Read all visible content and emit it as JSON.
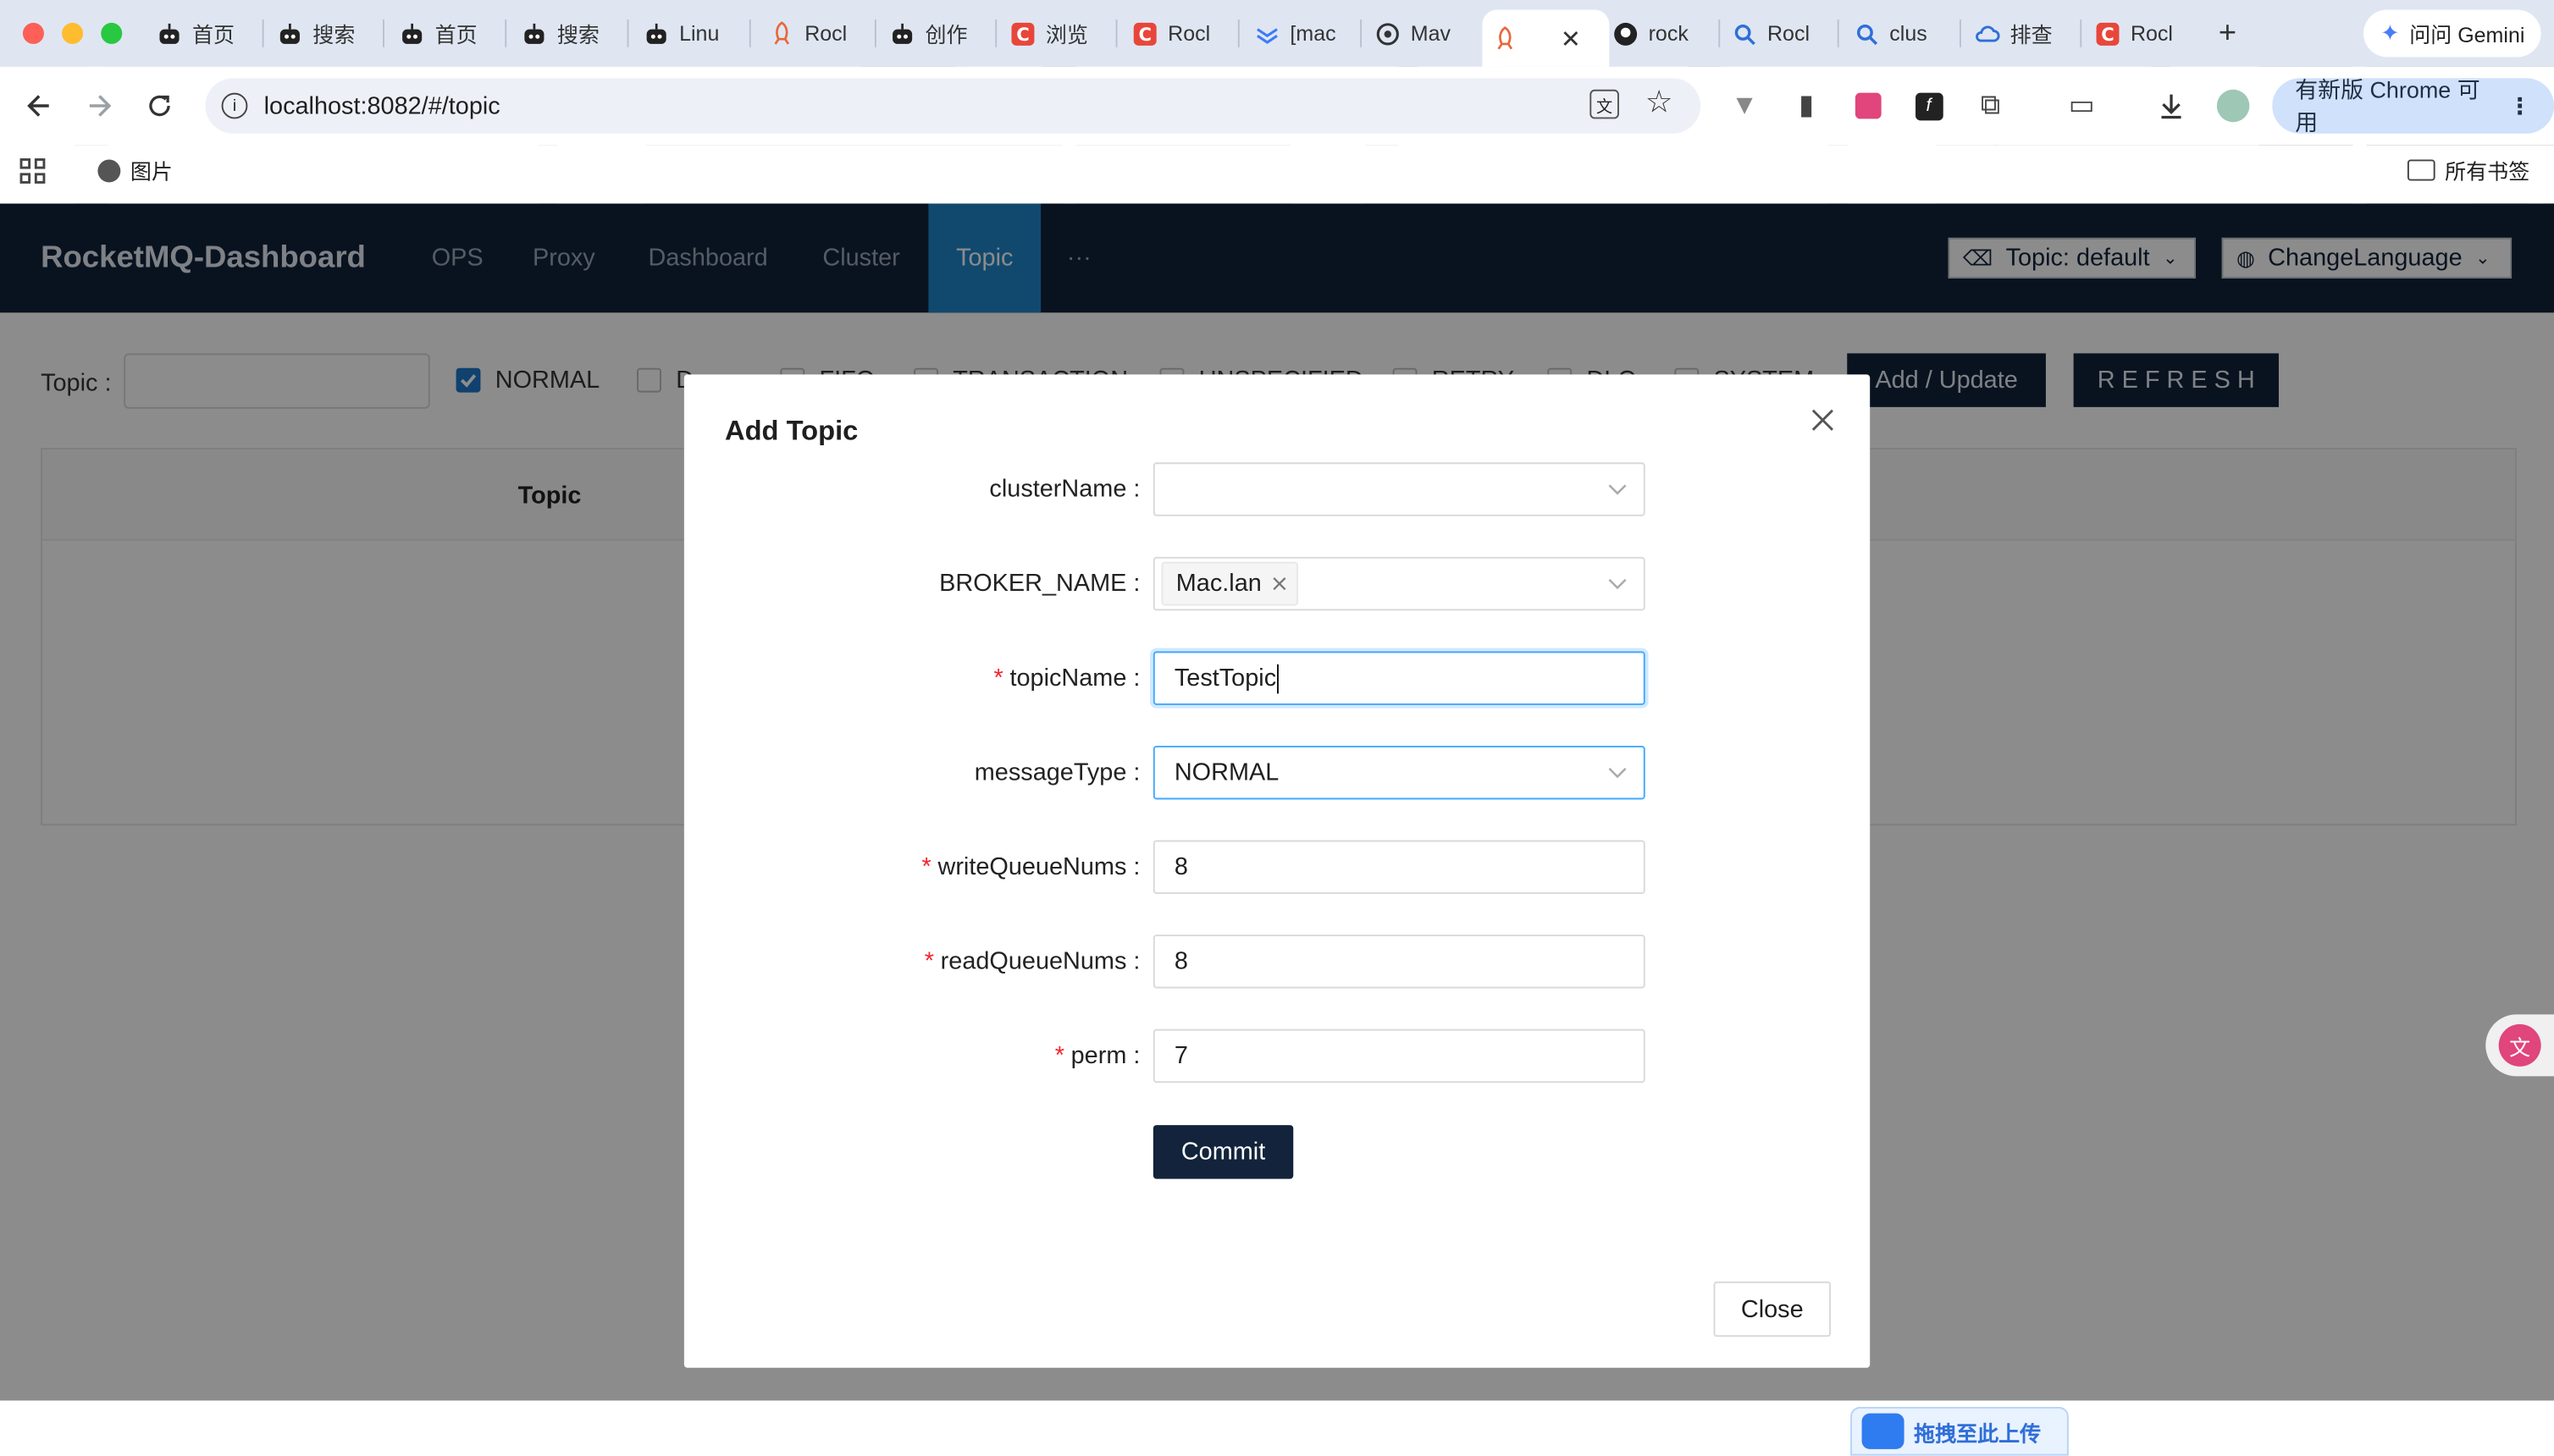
{
  "browser": {
    "tabs": [
      {
        "label": "首页",
        "icon": "robot-icon"
      },
      {
        "label": "搜索",
        "icon": "robot-icon"
      },
      {
        "label": "首页",
        "icon": "robot-icon"
      },
      {
        "label": "搜索",
        "icon": "robot-icon"
      },
      {
        "label": "Linu",
        "icon": "robot-icon"
      },
      {
        "label": "Rocl",
        "icon": "rocket-icon"
      },
      {
        "label": "创作",
        "icon": "robot-icon"
      },
      {
        "label": "浏览",
        "icon": "csdn-icon"
      },
      {
        "label": "Rocl",
        "icon": "csdn-icon"
      },
      {
        "label": "[mac",
        "icon": "feishu-icon"
      },
      {
        "label": "Mav",
        "icon": "openai-icon"
      },
      {
        "label": "",
        "icon": "rocket-icon"
      },
      {
        "label": "rock",
        "icon": "github-icon"
      },
      {
        "label": "Rocl",
        "icon": "search-icon"
      },
      {
        "label": "clus",
        "icon": "search-icon"
      },
      {
        "label": "排查",
        "icon": "cloud-icon"
      },
      {
        "label": "Rocl",
        "icon": "csdn-icon"
      }
    ],
    "new_tab": "+",
    "gemini_label": "问问 Gemini",
    "url": "localhost:8082/#/topic",
    "update_label": "有新版 Chrome 可用",
    "bookmarks": {
      "first": "图片",
      "all": "所有书签"
    }
  },
  "app": {
    "brand": "RocketMQ-Dashboard",
    "nav": [
      "OPS",
      "Proxy",
      "Dashboard",
      "Cluster",
      "Topic",
      "···"
    ],
    "active_nav": "Topic",
    "topic_select": "Topic: default",
    "language_select": "ChangeLanguage",
    "filter": {
      "label": "Topic :",
      "types": [
        {
          "label": "NORMAL",
          "checked": true
        },
        {
          "label": "D",
          "checked": false
        },
        {
          "label": "FIFO",
          "checked": false
        },
        {
          "label": "TRANSACTION",
          "checked": false
        },
        {
          "label": "UNSPECIFIED",
          "checked": false
        },
        {
          "label": "RETRY",
          "checked": false
        },
        {
          "label": "DLQ",
          "checked": false
        },
        {
          "label": "SYSTEM",
          "checked": false
        }
      ],
      "add_update": "Add / Update",
      "refresh": "R E F R E S H"
    },
    "table": {
      "header_topic": "Topic"
    }
  },
  "modal": {
    "title": "Add Topic",
    "fields": {
      "clusterName": {
        "label": "clusterName",
        "value": "",
        "required": false
      },
      "brokerName": {
        "label": "BROKER_NAME",
        "tag": "Mac.lan",
        "required": false
      },
      "topicName": {
        "label": "topicName",
        "value": "TestTopic",
        "required": true
      },
      "messageType": {
        "label": "messageType",
        "value": "NORMAL",
        "required": false
      },
      "writeQueueNums": {
        "label": "writeQueueNums",
        "value": "8",
        "required": true
      },
      "readQueueNums": {
        "label": "readQueueNums",
        "value": "8",
        "required": true
      },
      "perm": {
        "label": "perm",
        "value": "7",
        "required": true
      }
    },
    "colon": ":",
    "required_mark": "*",
    "commit": "Commit",
    "close": "Close"
  },
  "floating": {
    "upload_label": "拖拽至此上传"
  }
}
